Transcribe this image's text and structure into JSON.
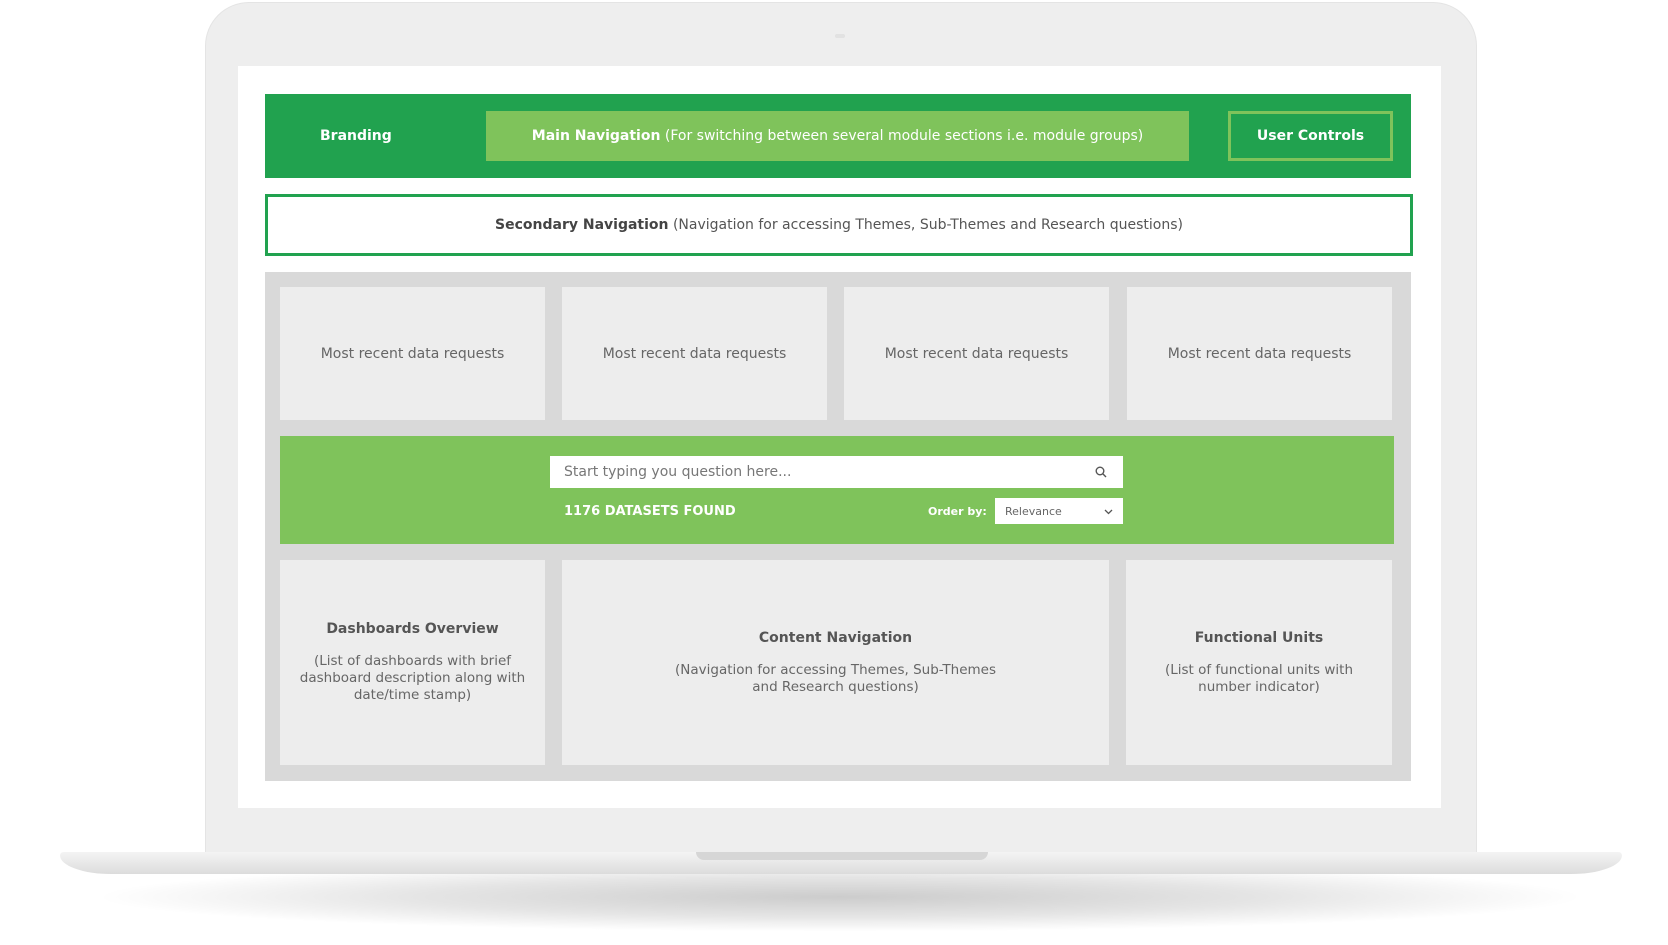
{
  "header": {
    "branding": "Branding",
    "main_nav_title": "Main Navigation",
    "main_nav_desc": "(For switching between several module sections i.e. module groups)",
    "user_controls": "User Controls"
  },
  "secondary_nav": {
    "title": "Secondary Navigation",
    "desc": "(Navigation for accessing Themes, Sub-Themes and Research questions)"
  },
  "recent_requests": [
    {
      "label": "Most recent data requests"
    },
    {
      "label": "Most recent data requests"
    },
    {
      "label": "Most recent data requests"
    },
    {
      "label": "Most recent data requests"
    }
  ],
  "search": {
    "placeholder": "Start typing you question here...",
    "results": "1176 DATASETS FOUND",
    "order_label": "Order by:",
    "order_value": "Relevance"
  },
  "sections": {
    "dashboards": {
      "title": "Dashboards Overview",
      "desc": "(List of dashboards with brief dashboard description along with date/time stamp)"
    },
    "content": {
      "title": "Content Navigation",
      "desc": "(Navigation for accessing Themes, Sub-Themes and Research questions)"
    },
    "functional": {
      "title": "Functional Units",
      "desc": "(List of functional units with number indicator)"
    }
  },
  "colors": {
    "brand_green": "#21a24f",
    "light_green": "#7fc35b",
    "panel_gray": "#d9d9d9",
    "card_gray": "#ededed"
  },
  "icons": {
    "search": "search-icon",
    "dropdown": "chevron-down-icon"
  }
}
